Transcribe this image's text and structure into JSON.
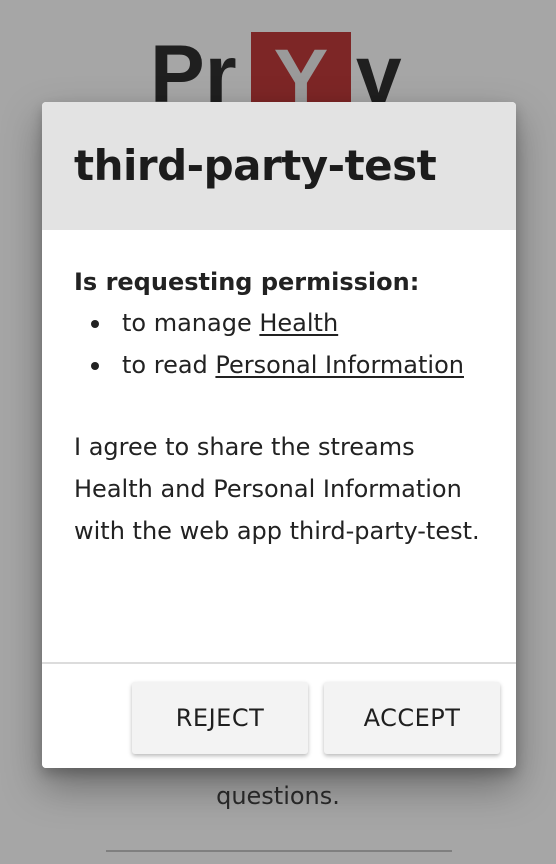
{
  "background": {
    "logo": {
      "text_prefix": "Pr",
      "boxed_letter": "Y",
      "text_suffix": "v",
      "box_color": "#7d2626"
    },
    "footer_lines": [
      "questions.",
      "questions."
    ],
    "footer_visible": [
      "…",
      "questions."
    ]
  },
  "dialog": {
    "title": "third-party-test",
    "permissions_heading": "Is requesting permission:",
    "permissions": [
      {
        "prefix": "to manage ",
        "stream": "Health"
      },
      {
        "prefix": "to read ",
        "stream": "Personal Information"
      }
    ],
    "agreement_text": "I agree to share the streams Health and Personal Information with the web app third-party-test.",
    "buttons": {
      "reject_label": "REJECT",
      "accept_label": "ACCEPT"
    }
  },
  "colors": {
    "overlay": "#a6a6a6",
    "header_bg": "#e3e3e3",
    "button_bg": "#f3f3f3"
  }
}
